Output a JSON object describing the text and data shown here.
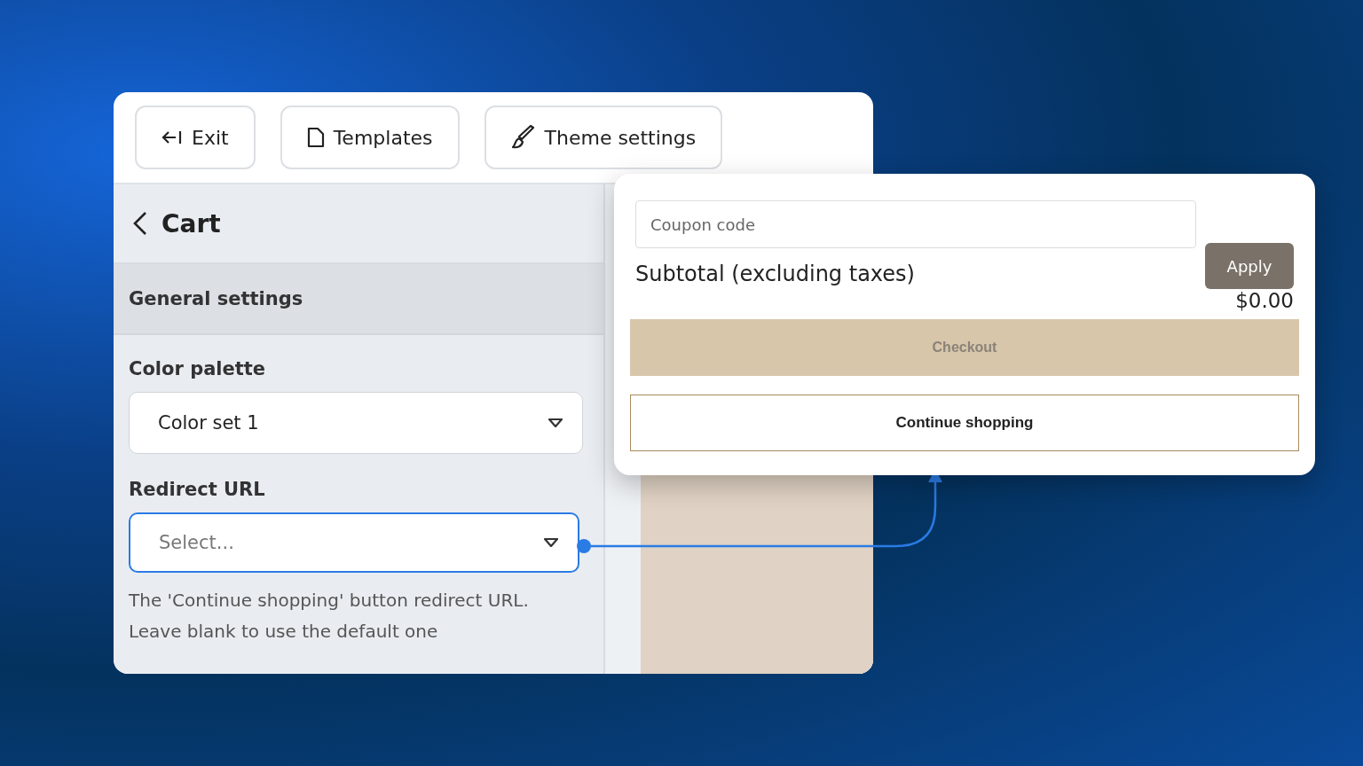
{
  "toolbar": {
    "buttons": [
      {
        "kind": "exit",
        "label": "Exit"
      },
      {
        "kind": "page",
        "label": "Templates"
      },
      {
        "kind": "brush",
        "label": "Theme settings"
      }
    ]
  },
  "sidebar": {
    "title": "Cart",
    "section": "General settings",
    "fields": [
      {
        "label": "Color palette",
        "value": "Color set 1",
        "focused": false
      },
      {
        "label": "Redirect URL",
        "placeholder": "Select...",
        "focused": true
      }
    ],
    "help_lines": [
      "The 'Continue shopping' button redirect URL.",
      "Leave blank to use the default one"
    ]
  },
  "cart": {
    "coupon": {
      "placeholder": "Coupon code"
    },
    "apply": "Apply",
    "subtotal_label": "Subtotal (excluding taxes)",
    "subtotal": "$0.00",
    "checkout": {
      "label": "Checkout",
      "disabled": true
    },
    "continue": "Continue shopping"
  }
}
